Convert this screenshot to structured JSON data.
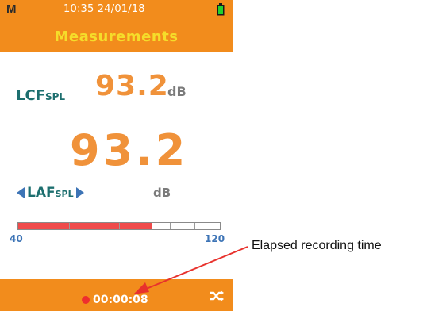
{
  "status": {
    "mode": "M",
    "time_date": "10:35  24/01/18",
    "battery_icon": "battery-full-icon"
  },
  "header": {
    "title": "Measurements"
  },
  "primary_reading": {
    "label_main": "LCF",
    "label_sub": "SPL",
    "value": "93.2",
    "unit": "dB"
  },
  "main_reading": {
    "value": "93.2",
    "label_main": "LAF",
    "label_sub": "SPL",
    "unit": "dB"
  },
  "meter": {
    "min_label": "40",
    "max_label": "120",
    "min_value": 40,
    "max_value": 120,
    "level_db": 93.2
  },
  "footer": {
    "elapsed": "00:00:08",
    "shuffle_icon": "shuffle-icon"
  },
  "annotation": {
    "text": "Elapsed recording time"
  },
  "colors": {
    "accent": "#f28c1c",
    "title": "#f5dd2a",
    "value": "#f0923a",
    "label": "#1d6f6f",
    "meter": "#ef4b4b",
    "arrow": "#e8312c"
  }
}
